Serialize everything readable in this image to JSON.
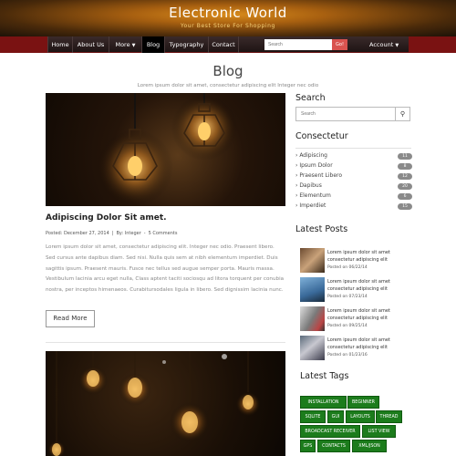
{
  "header": {
    "title": "Electronic World",
    "tagline": "Your Best Store For Shopping"
  },
  "nav": {
    "items": [
      "Home",
      "About Us",
      "More",
      "Blog",
      "Typography",
      "Contact"
    ],
    "active": "Blog",
    "search_placeholder": "Search",
    "search_button": "Go!",
    "account": "Account"
  },
  "page": {
    "title": "Blog",
    "subtitle": "Lorem ipsum dolor sit amet, consectetur adipiscing elit Integer nec odio"
  },
  "post": {
    "title": "Adipiscing Dolor Sit amet.",
    "posted": "Posted: December 27, 2014",
    "by": "By: Integer",
    "comments": "5 Comments",
    "excerpt": "Lorem ipsum dolor sit amet, consectetur adipiscing elit. Integer nec odio. Praesent libero. Sed cursus ante dapibus diam. Sed nisi. Nulla quis sem at nibh elementum imperdiet. Duis sagittis ipsum. Praesent mauris. Fusce nec tellus sed augue semper porta. Mauris massa. Vestibulum lacinia arcu eget nulla, Class aptent taciti sociosqu ad litora torquent per conubia nostra, per inceptos himenaeos. Curabitursodales ligula in libero. Sed dignissim lacinia nunc.",
    "read_more": "Read More"
  },
  "sidebar": {
    "search_title": "Search",
    "search_placeholder": "Search",
    "categories_title": "Consectetur",
    "categories": [
      {
        "label": "Adipiscing",
        "count": "11"
      },
      {
        "label": "Ipsum Dolor",
        "count": "8"
      },
      {
        "label": "Praesent Libero",
        "count": "12"
      },
      {
        "label": "Dapibus",
        "count": "20"
      },
      {
        "label": "Elementum",
        "count": "6"
      },
      {
        "label": "Imperdiet",
        "count": "15"
      }
    ],
    "latest_posts_title": "Latest Posts",
    "latest_posts": [
      {
        "text": "Lorem ipsum dolor sit amet consectetur adipiscing elit",
        "date": "Posted on 06/22/14"
      },
      {
        "text": "Lorem ipsum dolor sit amet consectetur adipiscing elit",
        "date": "Posted on 07/23/14"
      },
      {
        "text": "Lorem ipsum dolor sit amet consectetur adipiscing elit",
        "date": "Posted on 09/25/14"
      },
      {
        "text": "Lorem ipsum dolor sit amet consectetur adipiscing elit",
        "date": "Posted on 01/23/16"
      }
    ],
    "tags_title": "Latest Tags",
    "tags": [
      "INSTALLATION",
      "BEGINNER",
      "SQLITE",
      "GUI",
      "LAYOUTS",
      "THREAD",
      "BROADCAST RECEIVER",
      "LIST VIEW",
      "GPS",
      "CONTACTS",
      "XML/JSON"
    ]
  },
  "colors": {
    "nav_accent": "#7a1212",
    "tag_green": "#1c7c1c",
    "badge_gray": "#8a8a8a",
    "go_button": "#d9534f"
  }
}
